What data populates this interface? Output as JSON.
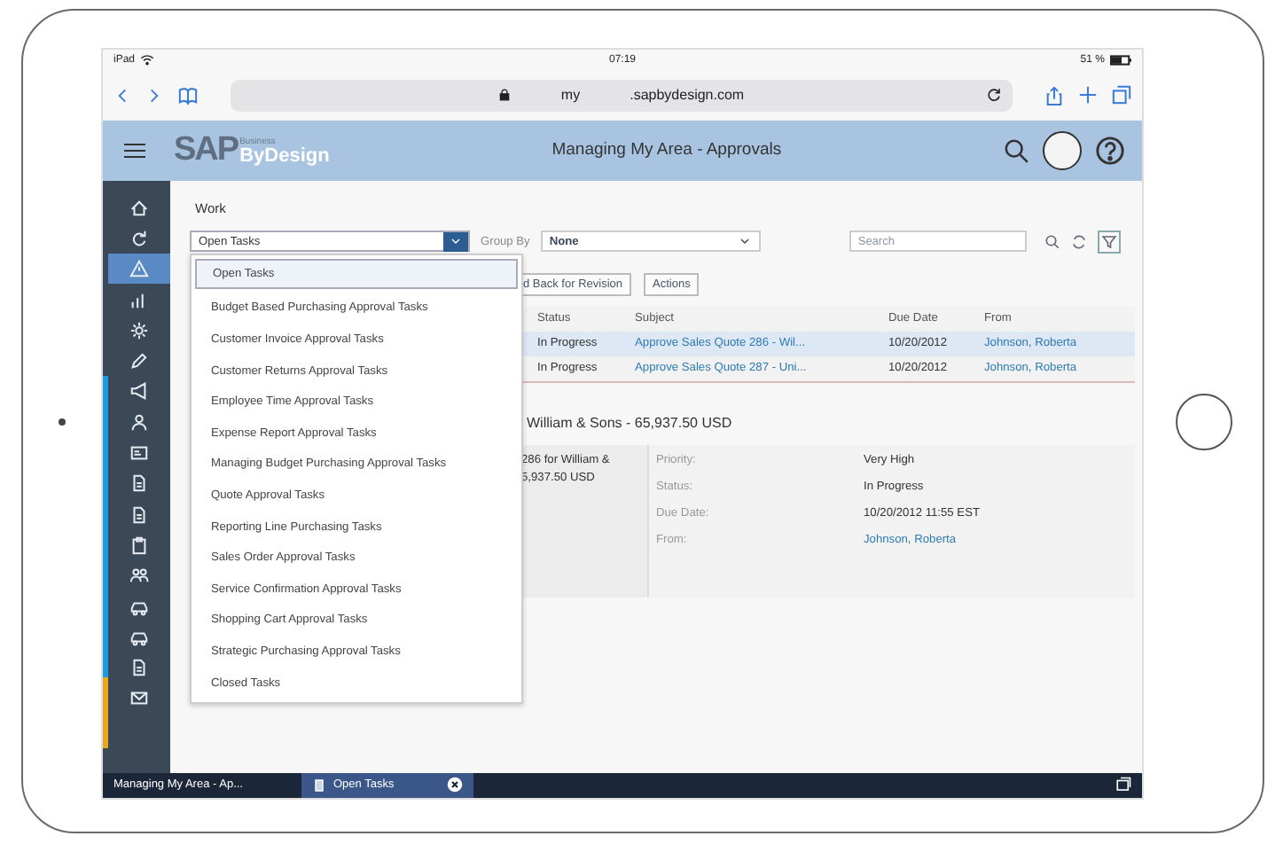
{
  "device_status": {
    "carrier": "iPad",
    "time": "07:19",
    "battery": "51 %"
  },
  "browser": {
    "url_prefix": "my",
    "url": ".sapbydesign.com"
  },
  "header": {
    "logo": "SAP",
    "logo_super": "Business",
    "logo_sub": "ByDesign",
    "title": "Managing My Area - Approvals"
  },
  "sidebar": {
    "items": [
      {
        "selected": false
      },
      {
        "selected": false
      },
      {
        "selected": true
      },
      {
        "selected": false
      },
      {
        "selected": false
      },
      {
        "selected": false
      },
      {
        "selected": false
      },
      {
        "selected": false
      },
      {
        "selected": false
      },
      {
        "selected": false
      },
      {
        "selected": false
      },
      {
        "selected": false
      },
      {
        "selected": false
      },
      {
        "selected": false
      },
      {
        "selected": false
      },
      {
        "selected": false
      },
      {
        "selected": false
      }
    ]
  },
  "work": {
    "heading": "Work",
    "view_select": {
      "value": "Open Tasks"
    },
    "group_by": {
      "label": "Group By",
      "value": "None"
    },
    "search": {
      "placeholder": "Search"
    }
  },
  "dropdown": {
    "items": [
      {
        "label": "Open Tasks",
        "selected": true
      },
      {
        "label": "Budget Based Purchasing Approval Tasks",
        "selected": false
      },
      {
        "label": "Customer Invoice Approval Tasks",
        "selected": false
      },
      {
        "label": "Customer Returns Approval Tasks",
        "selected": false
      },
      {
        "label": "Employee Time Approval Tasks",
        "selected": false
      },
      {
        "label": "Expense Report Approval Tasks",
        "selected": false
      },
      {
        "label": "Managing Budget Purchasing Approval Tasks",
        "selected": false
      },
      {
        "label": "Quote Approval Tasks",
        "selected": false
      },
      {
        "label": "Reporting Line Purchasing Tasks",
        "selected": false
      },
      {
        "label": "Sales Order Approval Tasks",
        "selected": false
      },
      {
        "label": "Service Confirmation Approval Tasks",
        "selected": false
      },
      {
        "label": "Shopping Cart Approval Tasks",
        "selected": false
      },
      {
        "label": "Strategic Purchasing Approval Tasks",
        "selected": false
      },
      {
        "label": "Closed Tasks",
        "selected": false
      }
    ]
  },
  "toolbar": {
    "buttons": [
      "d Back for Revision",
      "Actions"
    ]
  },
  "table": {
    "columns": [
      "Status",
      "Subject",
      "Due Date",
      "From"
    ],
    "rows": [
      {
        "status": "In Progress",
        "subject": "Approve Sales Quote 286 - Wil...",
        "due_date": "10/20/2012",
        "from": "Johnson, Roberta",
        "selected": true
      },
      {
        "status": "In Progress",
        "subject": "Approve Sales Quote 287 - Uni...",
        "due_date": "10/20/2012",
        "from": "Johnson, Roberta",
        "selected": false
      }
    ]
  },
  "detail": {
    "title": "William & Sons - 65,937.50 USD",
    "summary": [
      "286 for William &",
      "5,937.50 USD"
    ],
    "fields": [
      {
        "label": "Priority:",
        "value": "Very High",
        "kind": "text"
      },
      {
        "label": "Status:",
        "value": "In Progress",
        "kind": "text"
      },
      {
        "label": "Due Date:",
        "value": "10/20/2012 11:55 EST",
        "kind": "text"
      },
      {
        "label": "From:",
        "value": "Johnson, Roberta",
        "kind": "link"
      }
    ]
  },
  "taskbar": {
    "app": "Managing My Area - Ap...",
    "tabs": [
      {
        "label": "Open Tasks",
        "selected": true
      }
    ]
  }
}
